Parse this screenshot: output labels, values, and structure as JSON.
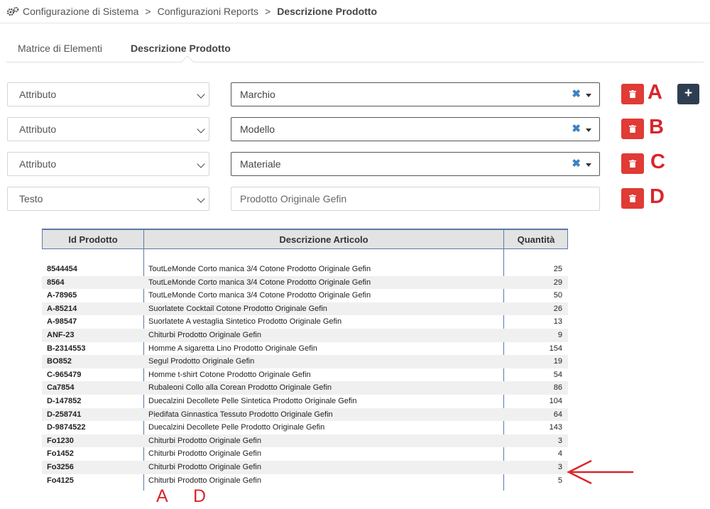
{
  "breadcrumb": {
    "items": [
      "Configurazione di Sistema",
      "Configurazioni Reports"
    ],
    "separator": ">",
    "current": "Descrizione Prodotto"
  },
  "tabs": [
    {
      "label": "Matrice di Elementi",
      "active": false
    },
    {
      "label": "Descrizione Prodotto",
      "active": true
    }
  ],
  "rows": [
    {
      "type": "Attributo",
      "value": "Marchio",
      "letter": "A"
    },
    {
      "type": "Attributo",
      "value": "Modello",
      "letter": "B"
    },
    {
      "type": "Attributo",
      "value": "Materiale",
      "letter": "C"
    },
    {
      "type": "Testo",
      "placeholder": "Prodotto Originale Gefin",
      "letter": "D"
    }
  ],
  "icons": {
    "breadcrumb": "gears-icon",
    "delete": "trash-icon",
    "add": "plus-icon",
    "clear": "close-icon",
    "dropdown": "chevron-down-icon"
  },
  "colors": {
    "delete_button": "#e03b35",
    "add_button": "#2e3e50",
    "annotation": "#d9262c",
    "grid_border": "#5a78a8",
    "clear_icon": "#3b82c4"
  },
  "grid": {
    "columns": [
      "Id Prodotto",
      "Descrizione Articolo",
      "Quantità"
    ],
    "rows": [
      [
        "8544454",
        "ToutLeMonde Corto manica 3/4 Cotone Prodotto Originale Gefin",
        "25"
      ],
      [
        "8564",
        "ToutLeMonde Corto manica 3/4 Cotone Prodotto Originale Gefin",
        "29"
      ],
      [
        "A-78965",
        "ToutLeMonde Corto manica 3/4 Cotone Prodotto Originale Gefin",
        "50"
      ],
      [
        "A-85214",
        "Suorlatete Cocktail Cotone Prodotto Originale Gefin",
        "26"
      ],
      [
        "A-98547",
        "Suorlatete A vestaglia Sintetico Prodotto Originale Gefin",
        "13"
      ],
      [
        "ANF-23",
        "Chiturbi Prodotto Originale Gefin",
        "9"
      ],
      [
        "B-2314553",
        "Homme A sigaretta Lino Prodotto Originale Gefin",
        "154"
      ],
      [
        "BO852",
        "Segul Prodotto Originale Gefin",
        "19"
      ],
      [
        "C-965479",
        "Homme t-shirt Cotone Prodotto Originale Gefin",
        "54"
      ],
      [
        "Ca7854",
        "Rubaleoni Collo alla Corean Prodotto Originale Gefin",
        "86"
      ],
      [
        "D-147852",
        "Duecalzini Decollete Pelle Sintetica Prodotto Originale Gefin",
        "104"
      ],
      [
        "D-258741",
        "Piedifata Ginnastica Tessuto Prodotto Originale Gefin",
        "64"
      ],
      [
        "D-9874522",
        "Duecalzini Decollete Pelle Prodotto Originale Gefin",
        "143"
      ],
      [
        "Fo1230",
        "Chiturbi Prodotto Originale Gefin",
        "3"
      ],
      [
        "Fo1452",
        "Chiturbi Prodotto Originale Gefin",
        "4"
      ],
      [
        "Fo3256",
        "Chiturbi Prodotto Originale Gefin",
        "3"
      ],
      [
        "Fo4125",
        "Chiturbi Prodotto Originale Gefin",
        "5"
      ]
    ]
  },
  "annotations": {
    "bottom_left": "A",
    "bottom_right": "D"
  }
}
